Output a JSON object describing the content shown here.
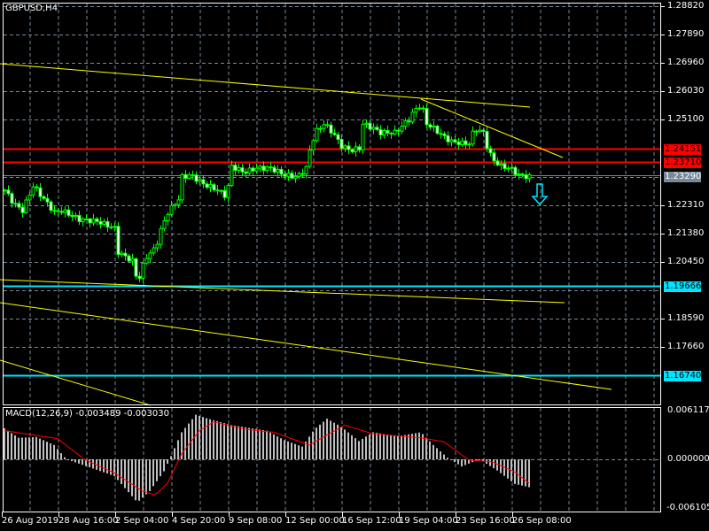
{
  "symbol_label": "GBPUSD,H4",
  "macd_label": "MACD(12,26,9) -0.003489 -0.003030",
  "price_axis": [
    "1.28820",
    "1.27890",
    "1.26960",
    "1.26030",
    "1.25100",
    "1.22310",
    "1.21380",
    "1.20450",
    "1.18590",
    "1.17660"
  ],
  "price_axis_values": [
    1.2882,
    1.2789,
    1.2696,
    1.2603,
    1.251,
    1.2231,
    1.2138,
    1.2045,
    1.1859,
    1.1766
  ],
  "macd_axis": [
    "0.006117",
    "0.000000",
    "-0.006105"
  ],
  "time_axis": [
    "26 Aug 2019",
    "28 Aug 16:00",
    "2 Sep 04:00",
    "4 Sep 20:00",
    "9 Sep 08:00",
    "12 Sep 00:00",
    "16 Sep 12:00",
    "19 Sep 04:00",
    "23 Sep 16:00",
    "26 Sep 08:00"
  ],
  "levels": {
    "red1": {
      "label": "1.24151",
      "price": 1.24151,
      "color": "#ff0000"
    },
    "red2": {
      "label": "1.23710",
      "price": 1.2371,
      "color": "#ff0000"
    },
    "bid": {
      "label": "1.23290",
      "price": 1.2329,
      "color": "#778899"
    },
    "cyan1": {
      "label": "1.19666",
      "price": 1.19666,
      "color": "#00e5ff"
    },
    "cyan2": {
      "label": "1.16740",
      "price": 1.1674,
      "color": "#00e5ff"
    }
  },
  "colors": {
    "candle": "#00ff00",
    "trendline": "#ffff00",
    "macd_hist": "#c0c0c0",
    "macd_signal": "#ff0000",
    "grid": "#778899"
  },
  "chart_data": {
    "type": "candlestick",
    "bars": 149,
    "close_keypoints": [
      [
        0,
        1.228
      ],
      [
        2.5,
        1.2236
      ],
      [
        5,
        1.2213
      ],
      [
        8,
        1.2294
      ],
      [
        11,
        1.2251
      ],
      [
        14,
        1.2207
      ],
      [
        16,
        1.2213
      ],
      [
        21,
        1.2184
      ],
      [
        26,
        1.2178
      ],
      [
        31,
        1.2155
      ],
      [
        32,
        1.2077
      ],
      [
        34,
        1.2062
      ],
      [
        36,
        1.2048
      ],
      [
        37.5,
        1.1976
      ],
      [
        39,
        1.2033
      ],
      [
        40,
        1.2062
      ],
      [
        42.5,
        1.2091
      ],
      [
        44,
        1.2149
      ],
      [
        46,
        1.2207
      ],
      [
        49,
        1.2251
      ],
      [
        50,
        1.2323
      ],
      [
        52.5,
        1.2329
      ],
      [
        56,
        1.23
      ],
      [
        60,
        1.228
      ],
      [
        62.5,
        1.2259
      ],
      [
        64,
        1.2358
      ],
      [
        67.5,
        1.2338
      ],
      [
        71,
        1.2352
      ],
      [
        75,
        1.2352
      ],
      [
        79,
        1.2329
      ],
      [
        82.5,
        1.2323
      ],
      [
        85,
        1.2352
      ],
      [
        86,
        1.241
      ],
      [
        87.5,
        1.2468
      ],
      [
        90,
        1.2497
      ],
      [
        92.5,
        1.2468
      ],
      [
        95,
        1.2424
      ],
      [
        97.5,
        1.241
      ],
      [
        100,
        1.2416
      ],
      [
        101,
        1.2497
      ],
      [
        104,
        1.2482
      ],
      [
        106,
        1.2468
      ],
      [
        110,
        1.2468
      ],
      [
        114,
        1.2511
      ],
      [
        115.5,
        1.254
      ],
      [
        117.5,
        1.2561
      ],
      [
        119,
        1.2497
      ],
      [
        121,
        1.2482
      ],
      [
        124,
        1.2453
      ],
      [
        126,
        1.2439
      ],
      [
        129,
        1.2433
      ],
      [
        131,
        1.2433
      ],
      [
        132.5,
        1.2482
      ],
      [
        135,
        1.2468
      ],
      [
        136,
        1.2424
      ],
      [
        137.5,
        1.2381
      ],
      [
        140,
        1.2358
      ],
      [
        142.5,
        1.2352
      ],
      [
        145,
        1.2329
      ],
      [
        148,
        1.2323
      ]
    ],
    "macd_hist_keypoints": [
      [
        0,
        0.0039
      ],
      [
        4,
        0.0027
      ],
      [
        9,
        0.0028
      ],
      [
        14,
        0.0018
      ],
      [
        17.5,
        0.0
      ],
      [
        24,
        -0.001
      ],
      [
        31,
        -0.0021
      ],
      [
        37.5,
        -0.0054
      ],
      [
        41,
        -0.004
      ],
      [
        45,
        -0.0015
      ],
      [
        47,
        0.0004
      ],
      [
        50,
        0.0034
      ],
      [
        54,
        0.0056
      ],
      [
        57.5,
        0.0051
      ],
      [
        64,
        0.0043
      ],
      [
        74,
        0.0036
      ],
      [
        79,
        0.0024
      ],
      [
        84,
        0.0016
      ],
      [
        87.5,
        0.0038
      ],
      [
        91,
        0.0051
      ],
      [
        95,
        0.0041
      ],
      [
        100,
        0.0023
      ],
      [
        104,
        0.0034
      ],
      [
        111,
        0.0029
      ],
      [
        117.5,
        0.0034
      ],
      [
        121,
        0.0018
      ],
      [
        125,
        0.0002
      ],
      [
        129,
        -0.0009
      ],
      [
        134,
        0.0
      ],
      [
        139,
        -0.0014
      ],
      [
        144,
        -0.0031
      ],
      [
        148,
        -0.0035
      ]
    ],
    "macd_signal_keypoints": [
      [
        0,
        0.0036
      ],
      [
        9,
        0.003
      ],
      [
        15,
        0.0026
      ],
      [
        22.5,
        0.0
      ],
      [
        31,
        -0.0017
      ],
      [
        39,
        -0.004
      ],
      [
        42.5,
        -0.0045
      ],
      [
        46,
        -0.003
      ],
      [
        50,
        0.0007
      ],
      [
        55,
        0.0036
      ],
      [
        59,
        0.0047
      ],
      [
        67.5,
        0.0038
      ],
      [
        76,
        0.0034
      ],
      [
        86,
        0.0018
      ],
      [
        96,
        0.0043
      ],
      [
        104,
        0.0032
      ],
      [
        117.5,
        0.0027
      ],
      [
        124,
        0.0022
      ],
      [
        131,
        -0.0001
      ],
      [
        137.5,
        -0.0003
      ],
      [
        144,
        -0.0016
      ],
      [
        148,
        -0.003
      ]
    ],
    "price_range": [
      1.16,
      1.2882
    ],
    "macd_range": [
      -0.006105,
      0.006117
    ]
  }
}
